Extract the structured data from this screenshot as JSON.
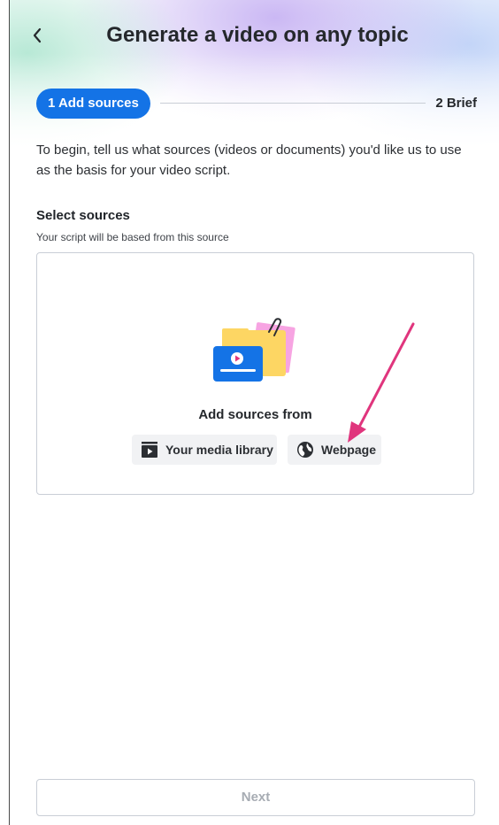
{
  "header": {
    "title": "Generate a video on any topic",
    "back_icon": "chevron-left-icon"
  },
  "stepper": {
    "steps": [
      {
        "label": "1 Add sources",
        "state": "active"
      },
      {
        "label": "2 Brief",
        "state": "inactive"
      }
    ]
  },
  "intro": {
    "text": "To begin, tell us what sources (videos or documents) you'd like us to use as the basis for your video script."
  },
  "sources": {
    "title": "Select sources",
    "subtitle": "Your script will be based from this source",
    "add_from_label": "Add sources from",
    "buttons": [
      {
        "label": "Your media library",
        "icon": "media-library-icon"
      },
      {
        "label": "Webpage",
        "icon": "globe-icon"
      }
    ]
  },
  "footer": {
    "next_label": "Next",
    "next_enabled": false
  },
  "colors": {
    "accent": "#1473e6",
    "annotation_arrow": "#e0357d",
    "folder_yellow": "#fdd663",
    "note_pink": "#f7a4e2",
    "disabled_text": "#a7acb3"
  }
}
